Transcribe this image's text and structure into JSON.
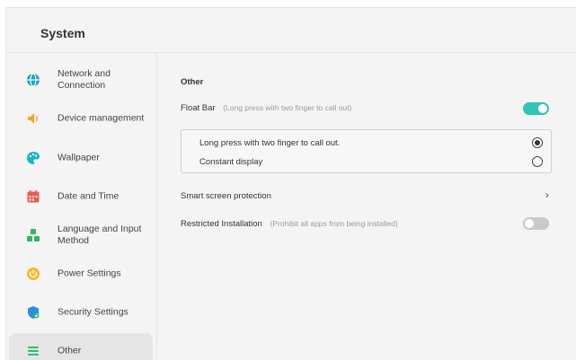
{
  "header": {
    "title": "System"
  },
  "sidebar": {
    "items": [
      {
        "label": "Network and Connection",
        "icon": "globe-icon",
        "color": "#19a3c9"
      },
      {
        "label": "Device management",
        "icon": "speaker-icon",
        "color": "#f5a623"
      },
      {
        "label": "Wallpaper",
        "icon": "palette-icon",
        "color": "#19b6c9"
      },
      {
        "label": "Date and Time",
        "icon": "calendar-icon",
        "color": "#ef5a4c"
      },
      {
        "label": "Language and Input Method",
        "icon": "language-icon",
        "color": "#34b55a"
      },
      {
        "label": "Power Settings",
        "icon": "power-icon",
        "color": "#f5b82e"
      },
      {
        "label": "Security Settings",
        "icon": "shield-icon",
        "color": "#2e8de0"
      },
      {
        "label": "Other",
        "icon": "menu-icon",
        "color": "#2bbf6a",
        "active": true
      }
    ]
  },
  "main": {
    "section_title": "Other",
    "float_bar": {
      "label": "Float Bar",
      "hint": "(Long press with two finger to call out)",
      "enabled": true,
      "options": [
        {
          "label": "Long press with two finger to call out.",
          "selected": true
        },
        {
          "label": "Constant display",
          "selected": false
        }
      ]
    },
    "smart_screen_protection": {
      "label": "Smart screen protection"
    },
    "restricted_installation": {
      "label": "Restricted Installation",
      "hint": "(Prohibit all apps from being installed)",
      "enabled": false
    }
  },
  "colors": {
    "accent": "#2ec4b6",
    "toggle_off": "#c9c9c9"
  }
}
